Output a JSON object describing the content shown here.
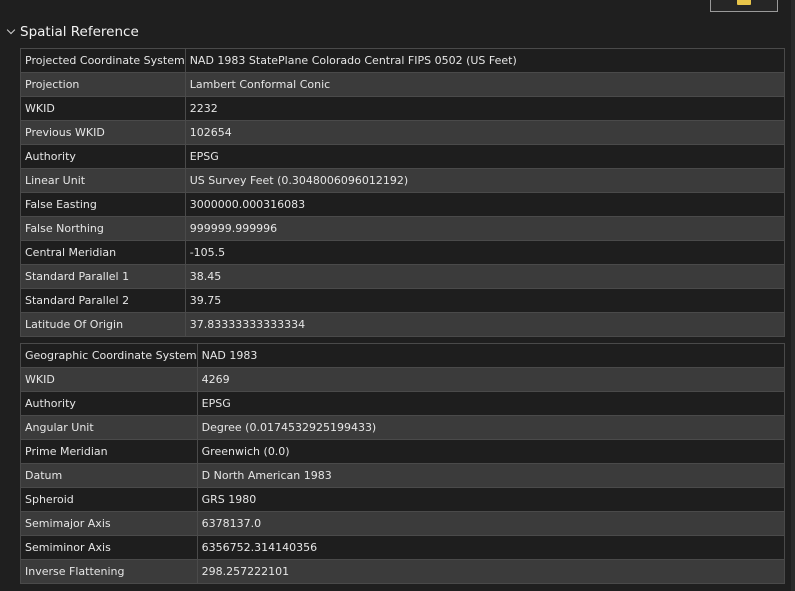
{
  "section": {
    "title": "Spatial Reference"
  },
  "projected": {
    "rows": [
      {
        "key": "Projected Coordinate System",
        "value": "NAD 1983 StatePlane Colorado Central FIPS 0502 (US Feet)"
      },
      {
        "key": "Projection",
        "value": "Lambert Conformal Conic"
      },
      {
        "key": "WKID",
        "value": "2232"
      },
      {
        "key": "Previous WKID",
        "value": "102654"
      },
      {
        "key": "Authority",
        "value": "EPSG"
      },
      {
        "key": "Linear Unit",
        "value": "US Survey Feet (0.3048006096012192)"
      },
      {
        "key": "False Easting",
        "value": "3000000.000316083"
      },
      {
        "key": "False Northing",
        "value": "999999.999996"
      },
      {
        "key": "Central Meridian",
        "value": "-105.5"
      },
      {
        "key": "Standard Parallel 1",
        "value": "38.45"
      },
      {
        "key": "Standard Parallel 2",
        "value": "39.75"
      },
      {
        "key": "Latitude Of Origin",
        "value": "37.83333333333334"
      }
    ]
  },
  "geographic": {
    "rows": [
      {
        "key": "Geographic Coordinate System",
        "value": "NAD 1983"
      },
      {
        "key": "WKID",
        "value": "4269"
      },
      {
        "key": "Authority",
        "value": "EPSG"
      },
      {
        "key": "Angular Unit",
        "value": "Degree (0.0174532925199433)"
      },
      {
        "key": "Prime Meridian",
        "value": "Greenwich (0.0)"
      },
      {
        "key": "Datum",
        "value": "D North American 1983"
      },
      {
        "key": "Spheroid",
        "value": "GRS 1980"
      },
      {
        "key": "Semimajor Axis",
        "value": "6378137.0"
      },
      {
        "key": "Semiminor Axis",
        "value": "6356752.314140356"
      },
      {
        "key": "Inverse Flattening",
        "value": "298.257222101"
      }
    ]
  },
  "icons": {
    "section_toggle": "chevron-down-icon",
    "folder": "folder-icon"
  }
}
